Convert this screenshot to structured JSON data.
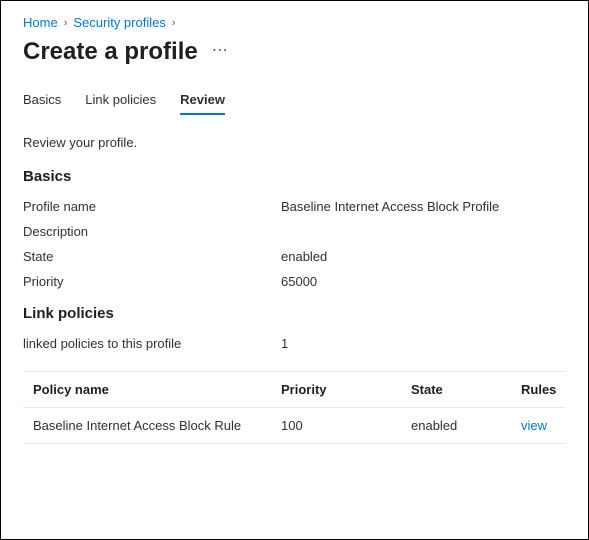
{
  "breadcrumb": {
    "home": "Home",
    "security_profiles": "Security profiles"
  },
  "page_title": "Create a profile",
  "tabs": {
    "basics": "Basics",
    "link_policies": "Link policies",
    "review": "Review"
  },
  "review_instruction": "Review your profile.",
  "sections": {
    "basics_heading": "Basics",
    "link_policies_heading": "Link policies"
  },
  "basics": {
    "profile_name_label": "Profile name",
    "profile_name_value": "Baseline Internet Access Block Profile",
    "description_label": "Description",
    "description_value": "",
    "state_label": "State",
    "state_value": "enabled",
    "priority_label": "Priority",
    "priority_value": "65000"
  },
  "link_policies": {
    "linked_count_label": "linked policies to this profile",
    "linked_count_value": "1",
    "columns": {
      "policy_name": "Policy name",
      "priority": "Priority",
      "state": "State",
      "rules": "Rules"
    },
    "rows": [
      {
        "policy_name": "Baseline Internet Access Block Rule",
        "priority": "100",
        "state": "enabled",
        "rules": "view"
      }
    ]
  }
}
